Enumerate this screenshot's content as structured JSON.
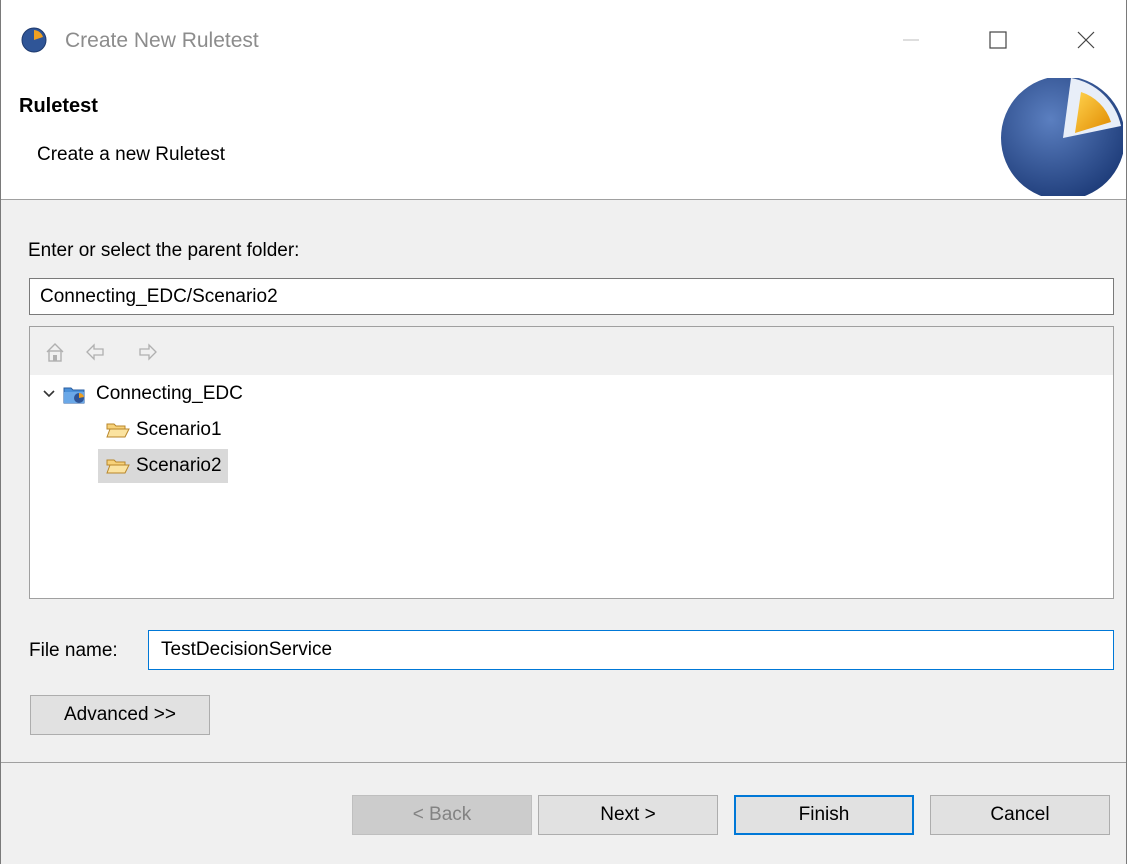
{
  "window": {
    "title": "Create New Ruletest"
  },
  "banner": {
    "title": "Ruletest",
    "description": "Create a new Ruletest"
  },
  "parent_folder": {
    "label": "Enter or select the parent folder:",
    "value": "Connecting_EDC/Scenario2"
  },
  "tree": {
    "toolbar_icons": [
      "home-icon",
      "back-arrow-icon",
      "forward-arrow-icon"
    ],
    "root": {
      "label": "Connecting_EDC",
      "expanded": true,
      "icon": "project-icon",
      "children": [
        {
          "label": "Scenario1",
          "icon": "folder-icon",
          "selected": false
        },
        {
          "label": "Scenario2",
          "icon": "folder-icon",
          "selected": true
        }
      ]
    }
  },
  "file_name": {
    "label": "File name:",
    "value": "TestDecisionService"
  },
  "buttons": {
    "advanced": "Advanced >>",
    "back": "< Back",
    "next": "Next >",
    "finish": "Finish",
    "cancel": "Cancel"
  },
  "colors": {
    "accent": "#0078d7",
    "dialog_bg": "#f0f0f0",
    "logo_blue": "#2f5597",
    "logo_orange": "#f0a020"
  }
}
